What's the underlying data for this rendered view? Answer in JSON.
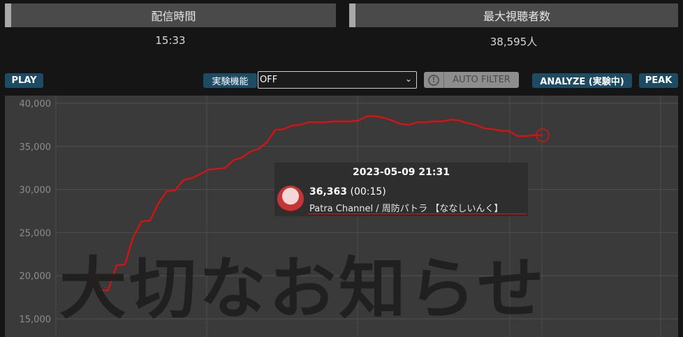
{
  "stats": {
    "duration": {
      "label": "配信時間",
      "value": "15:33"
    },
    "peak_viewers": {
      "label": "最大視聴者数",
      "value": "38,595人"
    }
  },
  "toolbar": {
    "play_label": "PLAY",
    "experimental_label": "実験機能",
    "experimental_select_value": "OFF",
    "auto_filter_label": "AUTO FILTER",
    "analyze_label": "ANALYZE (実験中)",
    "peak_label": "PEAK"
  },
  "tooltip": {
    "datetime": "2023-05-09 21:31",
    "value": "36,363",
    "elapsed": "(00:15)",
    "channel": "Patra Channel",
    "channel_jp": "周防パトラ 【ななしいんく】"
  },
  "banner_text": "大切なお知らせ",
  "colors": {
    "line": "#e01010",
    "accent_button": "#1c4b63",
    "background": "#151515",
    "plot_bg": "#3a3a3a"
  },
  "chart_data": {
    "type": "line",
    "y_ticks": [
      "40,000",
      "35,000",
      "30,000",
      "25,000",
      "20,000",
      "15,000"
    ],
    "ylim": [
      14000,
      40500
    ],
    "x": [
      0,
      1,
      2,
      3,
      4,
      5,
      6,
      7,
      8,
      9,
      10,
      11,
      12,
      13,
      14,
      15
    ],
    "series": [
      {
        "values": [
          21900,
          18300,
          18300,
          21200,
          21300,
          24500,
          26300,
          26400,
          28400,
          29800,
          29900,
          31100,
          31300,
          31800,
          32300,
          32400,
          32500,
          33400,
          33700,
          34400,
          34700,
          35500,
          36900,
          37000,
          37400,
          37500,
          37800,
          37800,
          37800,
          37900,
          37900,
          37900,
          38000,
          38500,
          38500,
          38300,
          38000,
          37600,
          37500,
          37800,
          37800,
          37900,
          37900,
          38100,
          38000,
          37700,
          37500,
          37100,
          37000,
          36800,
          36800,
          36200,
          36200,
          36300,
          36300
        ]
      }
    ],
    "highlight_index": 54,
    "grid": true
  }
}
